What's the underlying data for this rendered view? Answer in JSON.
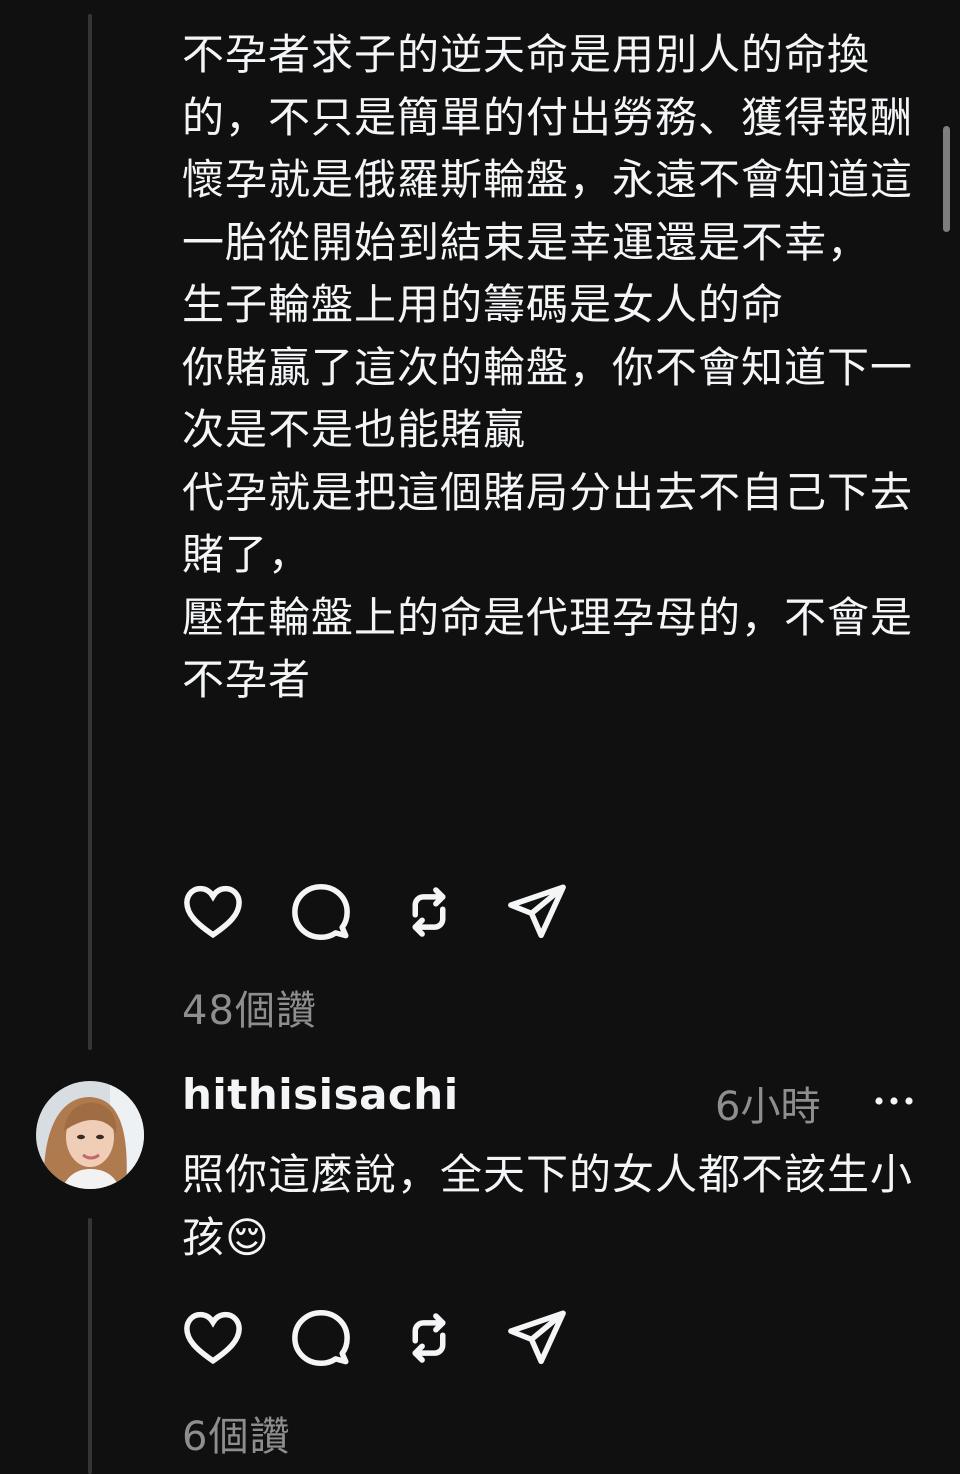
{
  "post": {
    "text": "不孕者求子的逆天命是用別人的命換的，不只是簡單的付出勞務、獲得報酬\n懷孕就是俄羅斯輪盤，永遠不會知道這一胎從開始到結束是幸運還是不幸，\n生子輪盤上用的籌碼是女人的命\n你賭贏了這次的輪盤，你不會知道下一次是不是也能賭贏\n代孕就是把這個賭局分出去不自己下去賭了，\n壓在輪盤上的命是代理孕母的，不會是不孕者",
    "likes": "48個讚"
  },
  "reply": {
    "username": "hithisisachi",
    "time": "6小時",
    "text": "照你這麼說，全天下的女人都不該生小孩😌",
    "likes": "6個讚"
  },
  "icons": {
    "like": "heart-icon",
    "comment": "comment-bubble-icon",
    "repost": "repost-icon",
    "share": "share-send-icon",
    "more": "more-dots-icon"
  },
  "colors": {
    "background": "#101010",
    "text": "#f3f5f7",
    "secondary": "#8e8e8e",
    "thread_line": "#333638"
  }
}
